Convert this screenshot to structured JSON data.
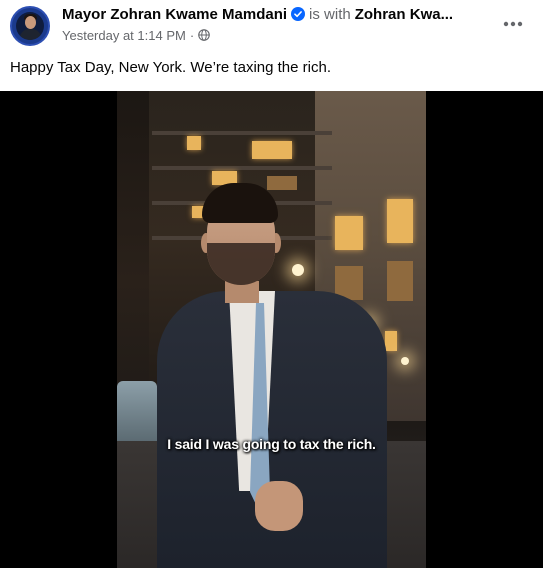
{
  "post": {
    "author": "Mayor Zohran Kwame Mamdani",
    "verified": true,
    "with_text": "is with",
    "tagged": "Zohran Kwa...",
    "timestamp": "Yesterday at 1:14 PM",
    "separator": "·",
    "audience_icon": "globe-icon",
    "text": "Happy Tax Day, New York. We’re taxing the rich."
  },
  "media": {
    "type": "video",
    "subtitle": "I said I was going to tax the rich."
  },
  "colors": {
    "verified_blue": "#0866ff",
    "secondary_text": "#65676b",
    "primary_text": "#050505"
  }
}
